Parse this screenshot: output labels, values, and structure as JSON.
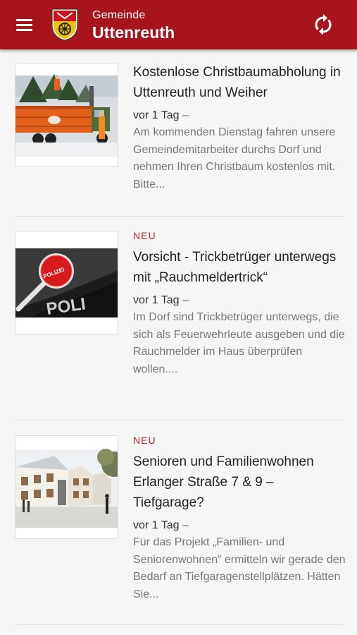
{
  "header": {
    "subtitle": "Gemeinde",
    "title": "Uttenreuth",
    "menu_icon": "hamburger-menu-icon",
    "refresh_icon": "sync-icon",
    "bg_color": "#a7141b"
  },
  "articles": [
    {
      "badge": "",
      "title": "Kostenlose Christbaumabholung in Uttenreuth und Weiher",
      "date": "vor 1 Tag",
      "dash": " –",
      "excerpt": "Am kommenden Dienstag fahren unsere Gemeindemitarbeiter durchs Dorf und nehmen Ihren Christbaum kostenlos mit. Bitte..."
    },
    {
      "badge": "NEU",
      "title": "Vorsicht - Trickbetrüger unterwegs mit „Rauchmeldertrick“",
      "date": "vor 1 Tag",
      "dash": " –",
      "excerpt": "Im Dorf sind Trickbetrüger unterwegs, die sich als Feuerwehrleute ausgeben und die Rauchmelder im Haus überprüfen wollen...."
    },
    {
      "badge": "NEU",
      "title": "Senioren und Familienwohnen Erlanger Straße 7 & 9 – Tiefgarage?",
      "date": "vor 1 Tag",
      "dash": " –",
      "excerpt": "Für das Projekt „Familien- und Seniorenwohnen“ ermitteln wir gerade den Bedarf an Tiefgaragenstellplätzen. Hätten Sie..."
    }
  ],
  "thumbnail_words": {
    "police_paddle": "POLIZEI",
    "police_car": "POLI"
  },
  "colors": {
    "accent": "#b5242c",
    "badge": "#b5242c"
  }
}
